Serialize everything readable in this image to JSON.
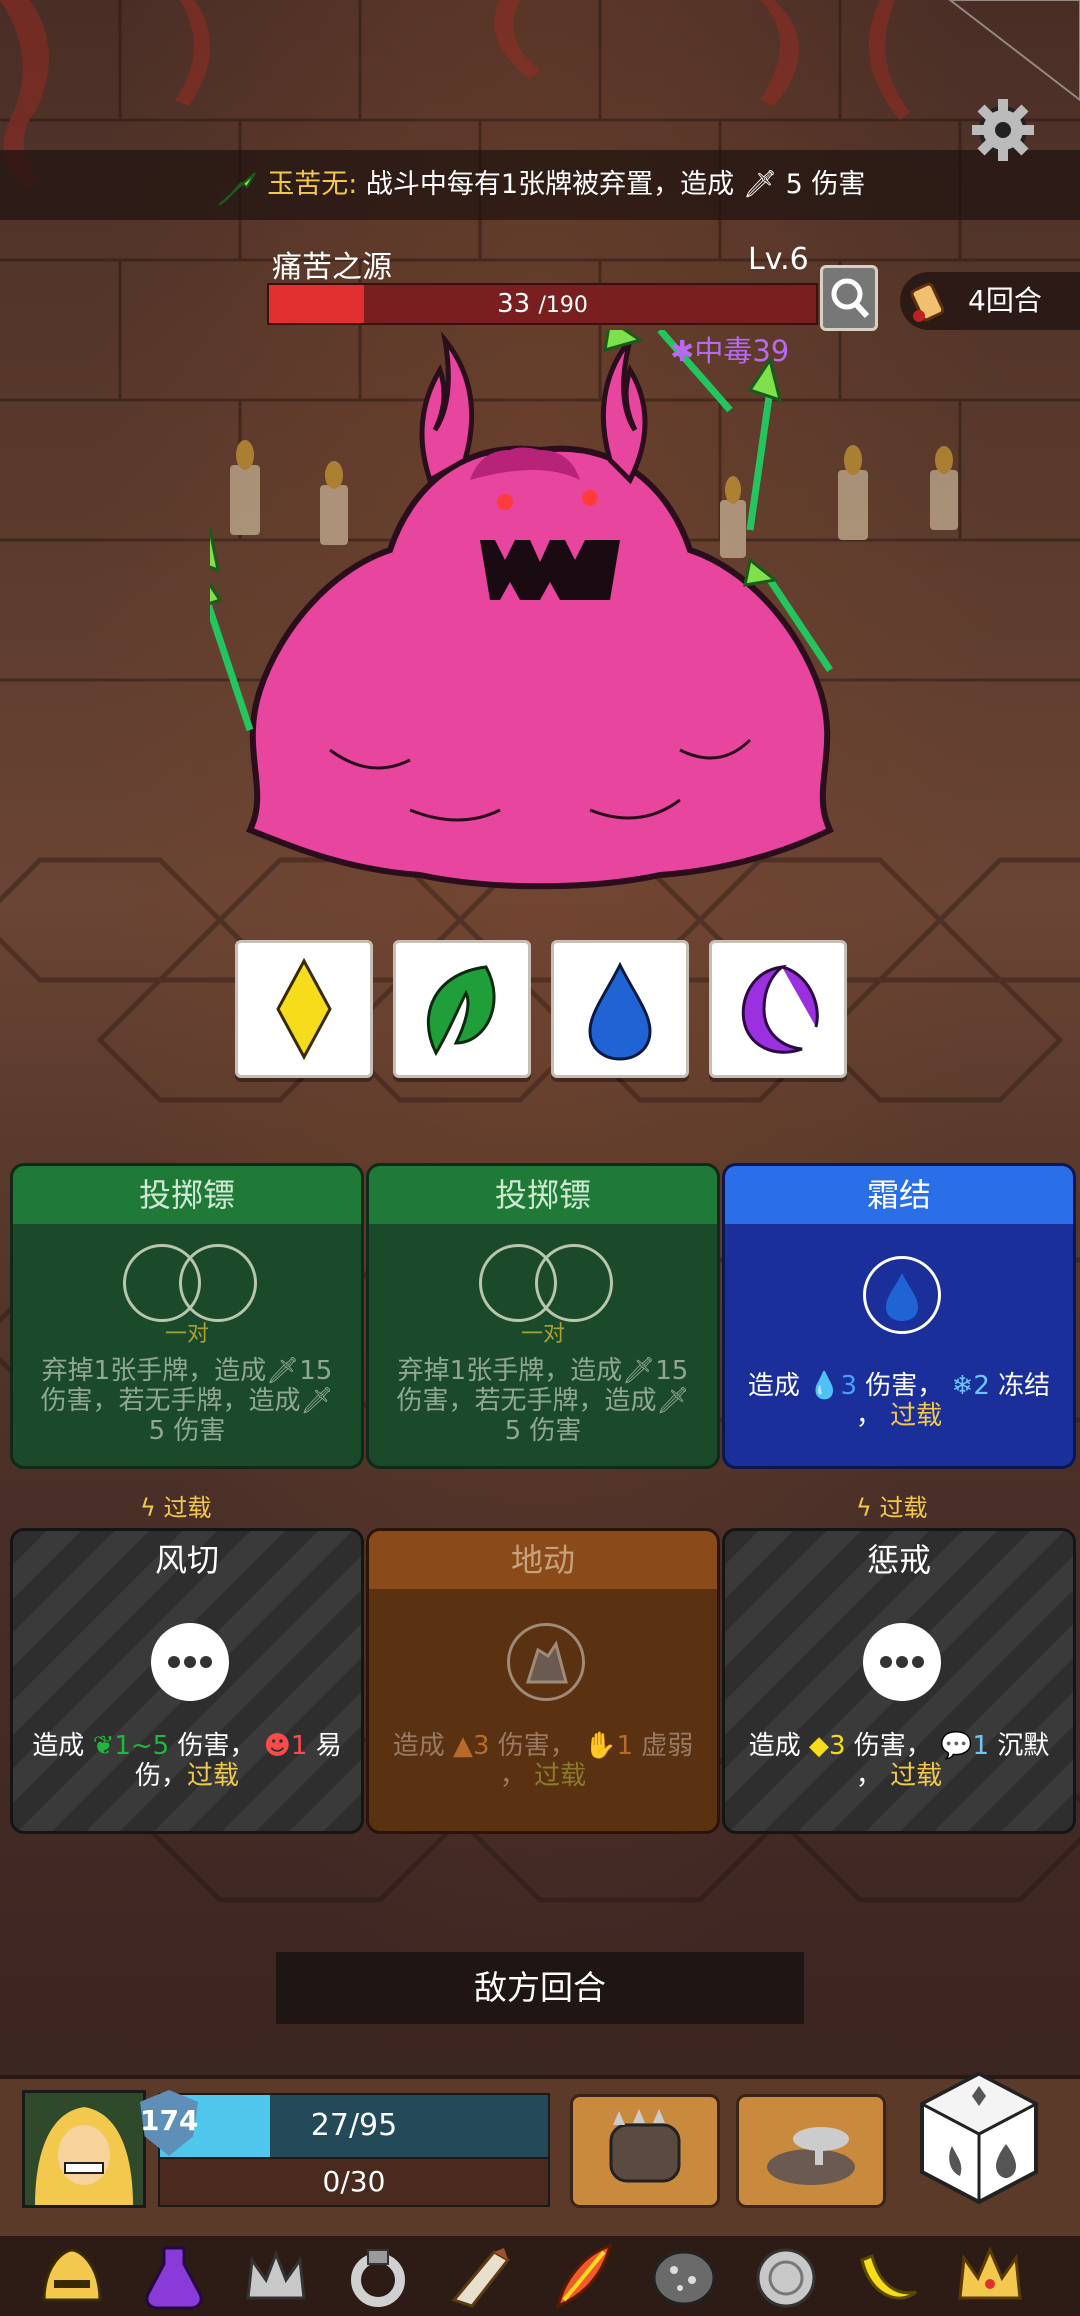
{
  "banner": {
    "relic_name": "玉苦无:",
    "relic_effect": "战斗中每有1张牌被弃置，造成",
    "damage_value": "5",
    "damage_suffix": "伤害"
  },
  "boss": {
    "name": "痛苦之源",
    "level": "Lv.6",
    "hp_current": "33",
    "hp_max": "/190",
    "hp_fraction": 0.1737,
    "status": "中毒39"
  },
  "round": "4回合",
  "dice": [
    {
      "icon": "yellow-diamond-icon",
      "color": "#f7dc1b"
    },
    {
      "icon": "green-leaf-icon",
      "color": "#1f9e3a"
    },
    {
      "icon": "blue-drop-icon",
      "color": "#1f63d4"
    },
    {
      "icon": "purple-moon-icon",
      "color": "#9b30e0"
    }
  ],
  "cards": [
    {
      "title": "投掷镖",
      "slot_label": "一对",
      "desc1": "弃掉1张手牌，造成",
      "v1": "15",
      "desc2": "伤害，若无手牌，造成",
      "desc3": "5 伤害"
    },
    {
      "title": "投掷镖",
      "slot_label": "一对",
      "desc1": "弃掉1张手牌，造成",
      "v1": "15",
      "desc2": "伤害，若无手牌，造成",
      "desc3": "5 伤害"
    },
    {
      "title": "霜结",
      "pre": "造成",
      "v1": "3",
      "mid": "伤害，",
      "v2": "2",
      "post": "冻结",
      "tail": "，",
      "keyword": "过载"
    },
    {
      "title": "风切",
      "badge": "过载",
      "pre": "造成",
      "v1": "1~5",
      "mid": "伤害，",
      "v2": "1",
      "post": "易",
      "line2": "伤，",
      "keyword": "过载"
    },
    {
      "title": "地动",
      "pre": "造成",
      "v1": "3",
      "mid": "伤害，",
      "v2": "1",
      "post": "虚弱",
      "tail": "，",
      "keyword": "过载"
    },
    {
      "title": "惩戒",
      "badge": "过载",
      "pre": "造成",
      "v1": "3",
      "mid": "伤害，",
      "v2": "1",
      "post": "沉默",
      "tail": "，",
      "keyword": "过载"
    }
  ],
  "enemy_turn": "敌方回合",
  "player": {
    "shield": "174",
    "hp": "27/95",
    "hp_fraction": 0.284,
    "energy": "0/30"
  },
  "relics": [
    "golden-helmet-icon",
    "purple-potion-icon",
    "silver-crown-icon",
    "silver-ring-icon",
    "war-horn-icon",
    "phoenix-feather-icon",
    "spotted-stone-icon",
    "silver-coin-icon",
    "banana-icon",
    "gold-crown-icon"
  ]
}
